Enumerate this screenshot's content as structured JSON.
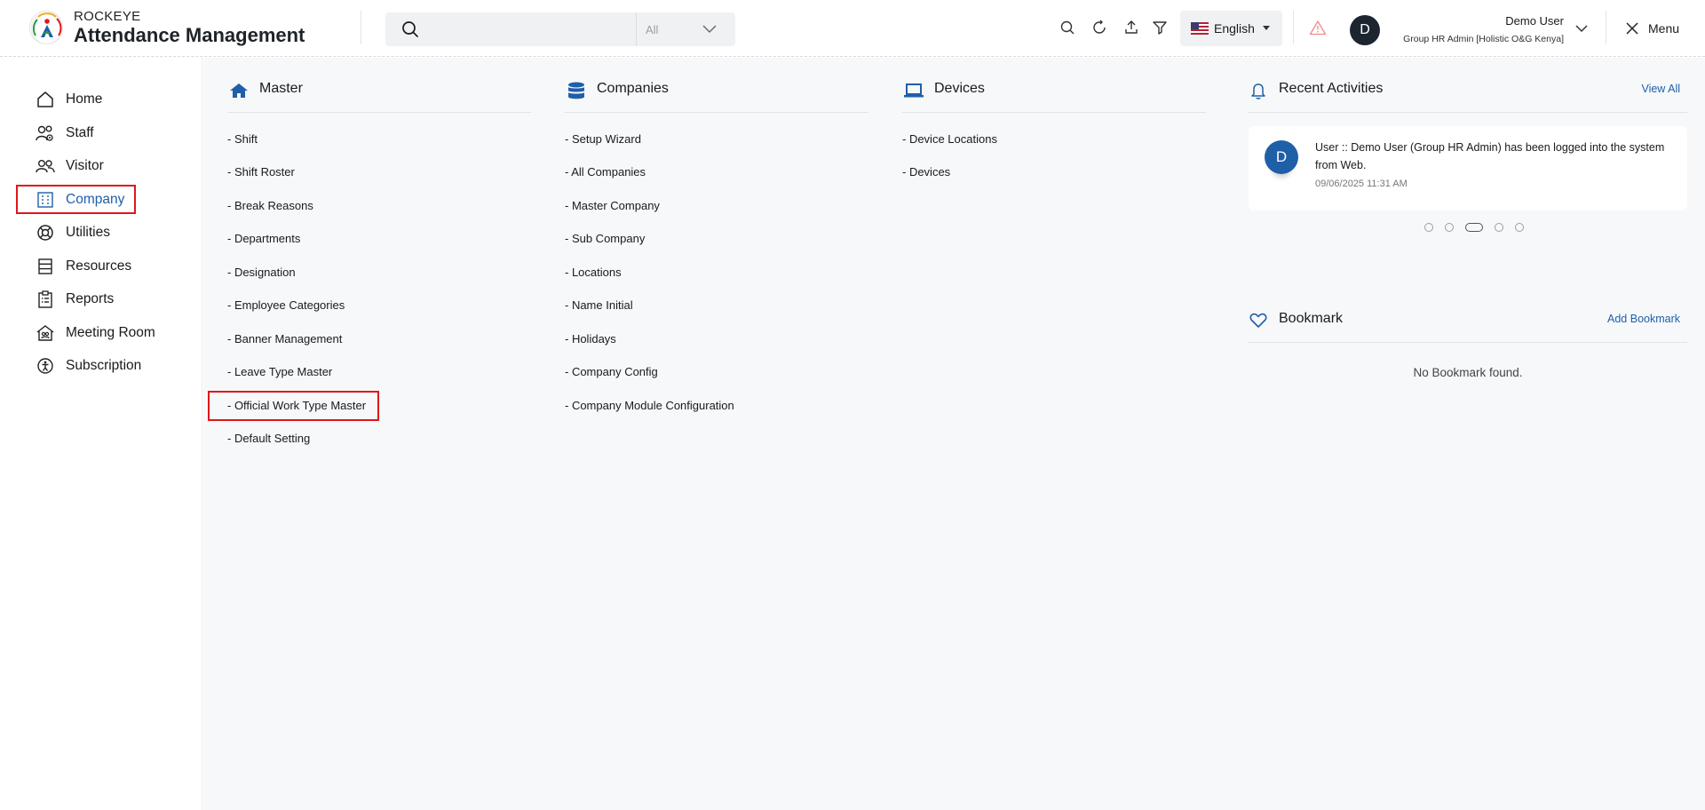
{
  "header": {
    "brand_small": "ROCKEYE",
    "brand_title": "Attendance Management",
    "search_placeholder": "",
    "search_scope": "All",
    "language": "English",
    "user_initial": "D",
    "user_name": "Demo User",
    "user_role": "Group HR Admin [Holistic O&G Kenya]",
    "menu_label": "Menu"
  },
  "sidebar": {
    "items": [
      {
        "label": "Home",
        "icon": "home-icon"
      },
      {
        "label": "Staff",
        "icon": "staff-icon"
      },
      {
        "label": "Visitor",
        "icon": "visitor-icon"
      },
      {
        "label": "Company",
        "icon": "building-icon",
        "active": true
      },
      {
        "label": "Utilities",
        "icon": "lifebuoy-icon"
      },
      {
        "label": "Resources",
        "icon": "resources-icon"
      },
      {
        "label": "Reports",
        "icon": "clipboard-icon"
      },
      {
        "label": "Meeting Room",
        "icon": "meeting-house-icon"
      },
      {
        "label": "Subscription",
        "icon": "subscription-icon"
      }
    ]
  },
  "columns": {
    "master": {
      "title": "Master",
      "links": [
        "- Shift",
        "- Shift Roster",
        "- Break Reasons",
        "- Departments",
        "- Designation",
        "- Employee Categories",
        "- Banner Management",
        "- Leave Type Master",
        "- Official Work Type Master",
        "- Default Setting"
      ]
    },
    "companies": {
      "title": "Companies",
      "links": [
        "- Setup Wizard",
        "- All Companies",
        "- Master Company",
        "- Sub Company",
        "- Locations",
        "- Name Initial",
        "- Holidays",
        "- Company Config",
        "- Company Module Configuration"
      ]
    },
    "devices": {
      "title": "Devices",
      "links": [
        "- Device Locations",
        "- Devices"
      ]
    }
  },
  "recent": {
    "title": "Recent Activities",
    "view_all": "View All",
    "avatar_initial": "D",
    "text": "User :: Demo User (Group HR Admin) has been logged into the system from Web.",
    "time": "09/06/2025 11:31 AM"
  },
  "bookmark": {
    "title": "Bookmark",
    "add_label": "Add Bookmark",
    "empty_text": "No Bookmark found."
  },
  "colors": {
    "accent": "#1f5fa8",
    "highlight": "#e0161b",
    "main_bg": "#f7f8fa"
  }
}
